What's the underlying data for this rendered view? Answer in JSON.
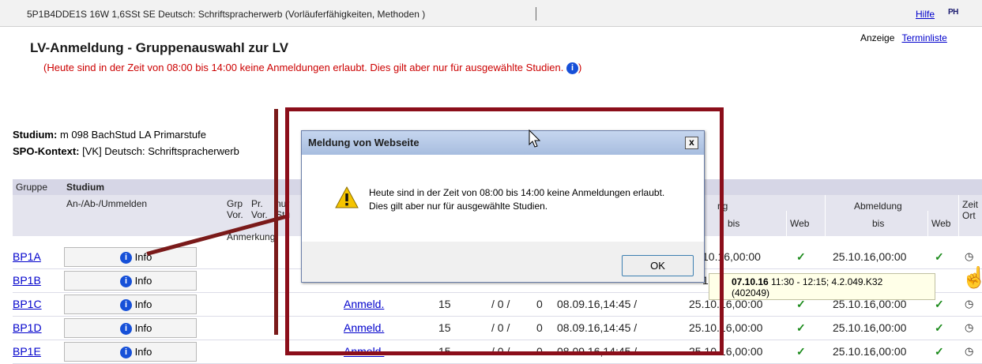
{
  "course": {
    "title": "5P1B4DDE1S 16W 1,6SSt SE Deutsch: Schriftspracherwerb (Vorläuferfähigkeiten, Methoden )"
  },
  "help_link": "Hilfe",
  "logo_text": "PH",
  "header": {
    "title": "LV-Anmeldung - Gruppenauswahl zur LV",
    "notice": "(Heute sind in der Zeit von 08:00 bis 14:00 keine Anmeldungen erlaubt. Dies gilt aber nur für ausgewählte Studien.",
    "notice_end": ")"
  },
  "top_right": {
    "anzeige": "Anzeige",
    "terminliste": "Terminliste"
  },
  "study": {
    "studium_label": "Studium:",
    "studium_value": " m 098 BachStud LA Primarstufe",
    "spo_label": "SPO-Kontext:",
    "spo_value": " [VK] Deutsch: Schriftspracherwerb"
  },
  "table": {
    "h_gruppe": "Gruppe",
    "h_studium": "Studium",
    "h_anab": "An-/Ab-/Ummelden",
    "h_grp": "Grp Vor.",
    "h_pr": "Pr. Vor.",
    "h_nur": "nur Stu",
    "h_anmerkung": "Anmerkung",
    "h_ng": "ng",
    "h_bis1": "bis",
    "h_web1": "Web",
    "h_abmeldung": "Abmeldung",
    "h_bis2": "bis",
    "h_web2": "Web",
    "h_zeit": "Zeit Ort",
    "info_label": "Info",
    "rows": [
      {
        "group": "BP1A",
        "anmeld": "",
        "num": "",
        "a": "",
        "b": "",
        "start": "",
        "bis1": "10.16,00:00",
        "bis2": "25.10.16,00:00"
      },
      {
        "group": "BP1B",
        "anmeld": "",
        "num": "",
        "a": "",
        "b": "",
        "start": "",
        "bis1": "10",
        "bis2": ""
      },
      {
        "group": "BP1C",
        "anmeld": "Anmeld.",
        "num": "15",
        "a": "/  0  /",
        "b": "0",
        "start": "08.09.16,14:45  /",
        "bis1": "25.10.16,00:00",
        "bis2": "25.10.16,00:00"
      },
      {
        "group": "BP1D",
        "anmeld": "Anmeld.",
        "num": "15",
        "a": "/  0  /",
        "b": "0",
        "start": "08.09.16,14:45  /",
        "bis1": "25.10.16,00:00",
        "bis2": "25.10.16,00:00"
      },
      {
        "group": "BP1E",
        "anmeld": "Anmeld.",
        "num": "15",
        "a": "/  0  /",
        "b": "0",
        "start": "08.09.16,14:45  /",
        "bis1": "25.10.16,00:00",
        "bis2": "25.10.16,00:00"
      }
    ]
  },
  "tooltip": {
    "bold": "07.10.16",
    "text": " 11:30 - 12:15; 4.2.049.K32",
    "line2": "(402049)"
  },
  "dialog": {
    "title": "Meldung von Webseite",
    "close": "x",
    "message": "Heute sind in der Zeit von 08:00  bis 14:00 keine Anmeldungen erlaubt. Dies gilt aber nur für ausgewählte Studien.",
    "ok": "OK"
  },
  "icons": {
    "warning": "warning-icon",
    "info": "info-icon",
    "clock": "clock-icon",
    "check": "check-icon"
  }
}
